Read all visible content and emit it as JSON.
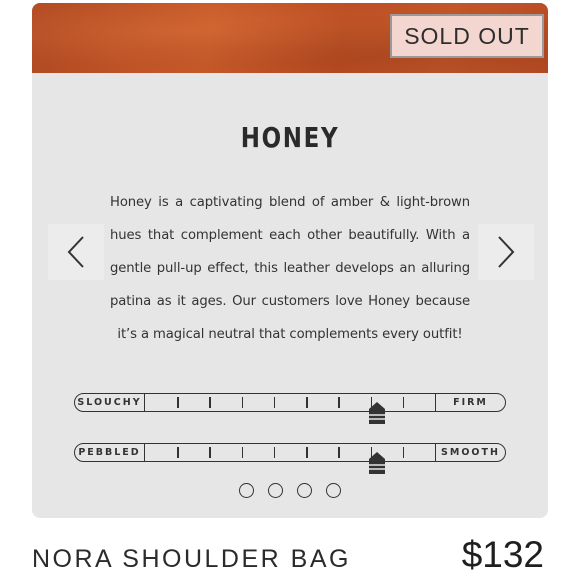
{
  "badge": {
    "label": "SOLD OUT"
  },
  "colors": {
    "swatch": "#c0532a",
    "badge_bg": "#f4d6d0",
    "card_bg": "#e6e6e6"
  },
  "leather": {
    "name": "HONEY",
    "description": "Honey is a captivating blend of amber & light-brown hues that complement each other beautifully. With a gentle pull-up effect, this leather develops an alluring patina as it ages. Our customers love Honey because it’s a magical neutral that complements every outfit!"
  },
  "carousel": {
    "prev_icon": "chevron-left-icon",
    "next_icon": "chevron-right-icon",
    "dot_count": 4
  },
  "scales": [
    {
      "left_label": "SLOUCHY",
      "right_label": "FIRM",
      "level": 0.8
    },
    {
      "left_label": "PEBBLED",
      "right_label": "SMOOTH",
      "level": 0.8
    }
  ],
  "product": {
    "name": "NORA SHOULDER BAG",
    "price": "$132"
  }
}
